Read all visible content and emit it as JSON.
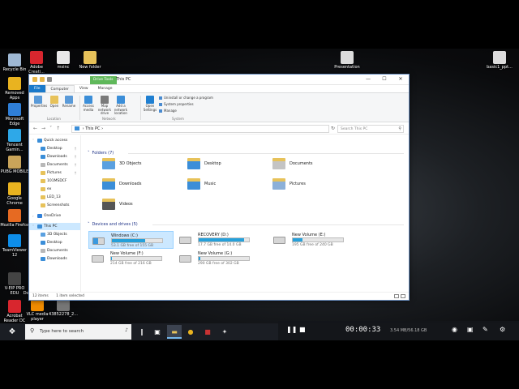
{
  "desktop": {
    "icons": [
      {
        "label": "Recycle Bin",
        "icon": "recycle-bin-icon",
        "color": "#9fb8d4"
      },
      {
        "label": "Adobe Creati...",
        "icon": "adobe-icon",
        "color": "#d8262e"
      },
      {
        "label": "msinc",
        "icon": "document-icon",
        "color": "#e8e8e8"
      },
      {
        "label": "New folder",
        "icon": "folder-icon",
        "color": "#e7c25a"
      },
      {
        "label": "Presentation",
        "icon": "document-icon",
        "color": "#dcdcdc"
      },
      {
        "label": "basic1_ppt...",
        "icon": "document-icon",
        "color": "#dcdcdc"
      },
      {
        "label": "Removed Apps",
        "icon": "chrome-icon",
        "color": "#e9b320"
      },
      {
        "label": "Microsoft Edge",
        "icon": "edge-icon",
        "color": "#2f7fd8"
      },
      {
        "label": "Tencent Gamin...",
        "icon": "tencent-icon",
        "color": "#2ea8e8"
      },
      {
        "label": "PUBG MOBILE",
        "icon": "pubg-icon",
        "color": "#c9a45a"
      },
      {
        "label": "Google Chrome",
        "icon": "chrome-icon",
        "color": "#e9b320"
      },
      {
        "label": "Mozilla Firefox",
        "icon": "firefox-icon",
        "color": "#e66a22"
      },
      {
        "label": "TeamViewer 12",
        "icon": "teamviewer-icon",
        "color": "#0e8ee9"
      },
      {
        "label": "V-EIP PRO EDU",
        "icon": "app-icon",
        "color": "#444444"
      },
      {
        "label": "New Text Document (3)",
        "icon": "text-document-icon",
        "color": "#f4f4f4"
      },
      {
        "label": "Wondershare Filmora8",
        "icon": "filmora-icon",
        "color": "#3fb7c9"
      },
      {
        "label": "Acrobat Reader DC",
        "icon": "acrobat-icon",
        "color": "#d8262e"
      },
      {
        "label": "VLC media player",
        "icon": "vlc-icon",
        "color": "#f08c00"
      },
      {
        "label": "43852278_2...",
        "icon": "image-icon",
        "color": "#777777"
      }
    ]
  },
  "explorer": {
    "context_tab": "Drive Tools",
    "title": "This PC",
    "window_controls": [
      "—",
      "☐",
      "✕"
    ],
    "ribbon_tabs": [
      "File",
      "Computer",
      "View",
      "Manage"
    ],
    "ribbon_buttons": [
      {
        "label": "Properties",
        "icon": "properties-icon",
        "color": "#5a9ad8"
      },
      {
        "label": "Open",
        "icon": "open-icon",
        "color": "#e7c25a"
      },
      {
        "label": "Rename",
        "icon": "rename-icon",
        "color": "#5a9ad8"
      },
      {
        "label": "Access media",
        "icon": "media-icon",
        "color": "#3b8ed8"
      },
      {
        "label": "Map network drive",
        "icon": "network-drive-icon",
        "color": "#7a7a7a"
      },
      {
        "label": "Add a network location",
        "icon": "network-location-icon",
        "color": "#3b8ed8"
      },
      {
        "label": "Open Settings",
        "icon": "gear-icon",
        "color": "#1f7fd1"
      }
    ],
    "ribbon_system_items": [
      "Uninstall or change a program",
      "System properties",
      "Manage"
    ],
    "ribbon_groups": [
      "Location",
      "Network",
      "System"
    ],
    "address": "This PC",
    "search_placeholder": "Search This PC",
    "nav": [
      {
        "label": "Quick access",
        "icon": "star-icon",
        "color": "#3b8ed8",
        "indent": 0
      },
      {
        "label": "Desktop",
        "icon": "desktop-folder-icon",
        "color": "#3b8ed8",
        "indent": 1,
        "pinned": true
      },
      {
        "label": "Downloads",
        "icon": "downloads-icon",
        "color": "#3b8ed8",
        "indent": 1,
        "pinned": true
      },
      {
        "label": "Documents",
        "icon": "documents-icon",
        "color": "#b8b8b8",
        "indent": 1,
        "pinned": true
      },
      {
        "label": "Pictures",
        "icon": "pictures-icon",
        "color": "#e7c25a",
        "indent": 1,
        "pinned": true
      },
      {
        "label": "101MSDCF",
        "icon": "folder-icon",
        "color": "#e7c25a",
        "indent": 1
      },
      {
        "label": "ex",
        "icon": "folder-icon",
        "color": "#e7c25a",
        "indent": 1
      },
      {
        "label": "LED_13",
        "icon": "folder-icon",
        "color": "#e7c25a",
        "indent": 1
      },
      {
        "label": "Screenshots",
        "icon": "folder-icon",
        "color": "#e7c25a",
        "indent": 1
      },
      {
        "label": "OneDrive",
        "icon": "cloud-icon",
        "color": "#2f7fd8",
        "indent": 0
      },
      {
        "label": "This PC",
        "icon": "computer-icon",
        "color": "#3b8ed8",
        "indent": 0,
        "selected": true
      },
      {
        "label": "3D Objects",
        "icon": "3d-objects-icon",
        "color": "#5aa0e0",
        "indent": 1
      },
      {
        "label": "Desktop",
        "icon": "desktop-folder-icon",
        "color": "#3b8ed8",
        "indent": 1
      },
      {
        "label": "Documents",
        "icon": "documents-icon",
        "color": "#b8b8b8",
        "indent": 1
      },
      {
        "label": "Downloads",
        "icon": "downloads-icon",
        "color": "#3b8ed8",
        "indent": 1
      }
    ],
    "folders_header": "Folders (7)",
    "folders": [
      {
        "label": "3D Objects",
        "icon": "3d-objects-icon",
        "color": "#5aa0e0"
      },
      {
        "label": "Desktop",
        "icon": "desktop-folder-icon",
        "color": "#3b8ed8"
      },
      {
        "label": "Documents",
        "icon": "documents-icon",
        "color": "#c4c4c4"
      },
      {
        "label": "Downloads",
        "icon": "downloads-icon",
        "color": "#3b8ed8"
      },
      {
        "label": "Music",
        "icon": "music-icon",
        "color": "#3b8ed8"
      },
      {
        "label": "Pictures",
        "icon": "pictures-icon",
        "color": "#8cb0d8"
      },
      {
        "label": "Videos",
        "icon": "videos-icon",
        "color": "#555555"
      }
    ],
    "drives_header": "Devices and drives (5)",
    "drives": [
      {
        "label": "Windows (C:)",
        "free": "53.1 GB free of 155 GB",
        "used_fraction": 0.66,
        "icon": "windows-drive-icon",
        "selected": true
      },
      {
        "label": "RECOVERY (D:)",
        "free": "17.7 GB free of 14.0 GB",
        "used_fraction": 0.9,
        "icon": "drive-icon"
      },
      {
        "label": "New Volume (E:)",
        "free": "195 GB free of 240 GB",
        "used_fraction": 0.19,
        "icon": "drive-icon"
      },
      {
        "label": "New Volume (F:)",
        "free": "214 GB free of 216 GB",
        "used_fraction": 0.01,
        "icon": "drive-icon"
      },
      {
        "label": "New Volume (G:)",
        "free": "290 GB free of 302 GB",
        "used_fraction": 0.04,
        "icon": "drive-icon"
      }
    ],
    "status_items": "12 items",
    "status_selected": "1 item selected"
  },
  "taskbar": {
    "search_placeholder": "Type here to search",
    "apps": [
      {
        "name": "task-view-icon",
        "glyph": "❙",
        "color": "#ffffff"
      },
      {
        "name": "store-icon",
        "glyph": "▣",
        "color": "#ffffff"
      },
      {
        "name": "file-explorer-icon",
        "glyph": "▬",
        "color": "#e7c25a",
        "active": true
      },
      {
        "name": "chrome-icon",
        "glyph": "●",
        "color": "#e9b320"
      },
      {
        "name": "media-app-icon",
        "glyph": "■",
        "color": "#c83333"
      },
      {
        "name": "tool-app-icon",
        "glyph": "✦",
        "color": "#dddddd"
      }
    ]
  },
  "recorder": {
    "time": "00:00:33",
    "size": "3.54 MB/56.18 GB"
  },
  "colors": {
    "accent": "#1979ca",
    "drive_bar": "#26a0da",
    "selection": "#cce8ff",
    "drive_tools": "#5fb85a"
  }
}
